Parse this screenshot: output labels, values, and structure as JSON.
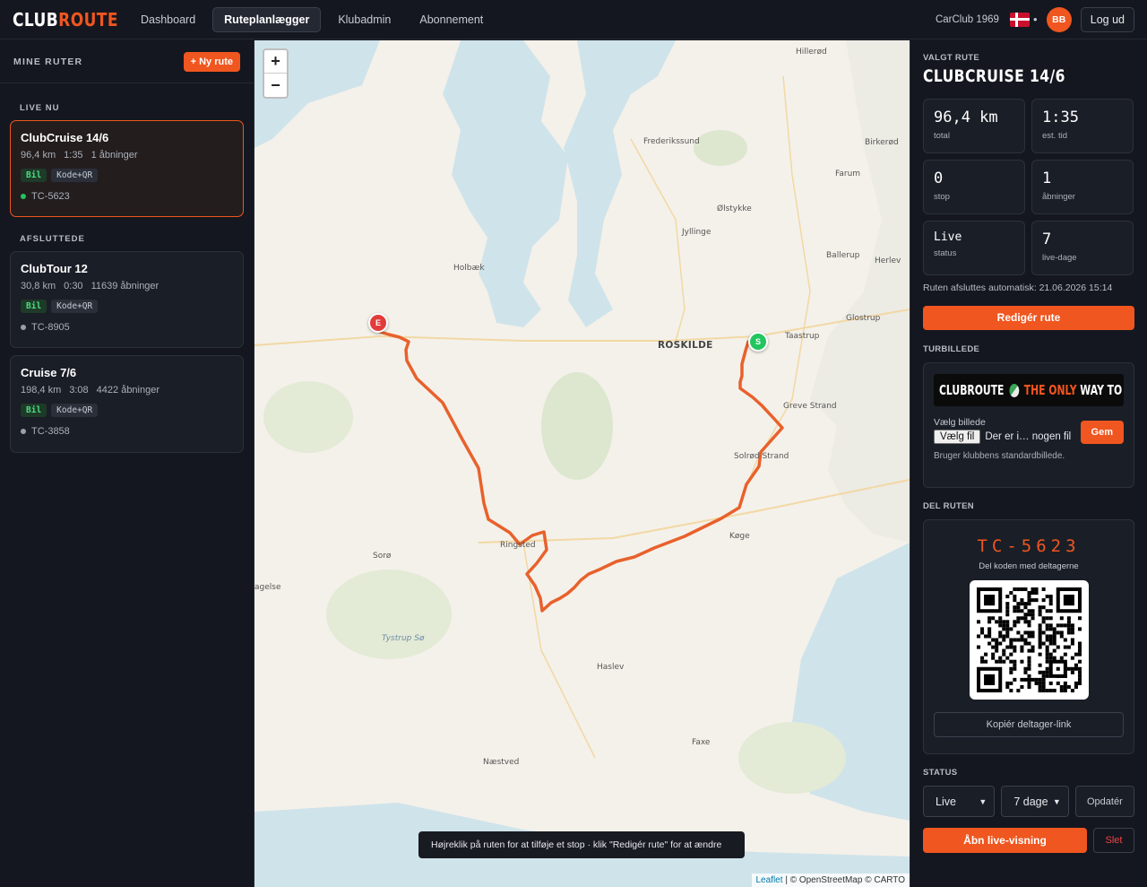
{
  "brand": {
    "part1": "CLUB",
    "part2": "ROUTE",
    "accent": "#f0561f"
  },
  "nav": {
    "items": [
      {
        "label": "Dashboard",
        "active": false
      },
      {
        "label": "Ruteplanlægger",
        "active": true
      },
      {
        "label": "Klubadmin",
        "active": false
      },
      {
        "label": "Abonnement",
        "active": false
      }
    ]
  },
  "header": {
    "club": "CarClub 1969",
    "language_flag": "denmark-flag-icon",
    "avatar": "BB",
    "logout": "Log ud"
  },
  "sidebar": {
    "title": "MINE RUTER",
    "new_route": "+ Ny rute",
    "live_label": "LIVE NU",
    "finished_label": "AFSLUTTEDE",
    "live_routes": [
      {
        "name": "ClubCruise 14/6",
        "km": "96,4 km",
        "time": "1:35",
        "openings": "1 åbninger",
        "tag1": "Bil",
        "tag2": "Kode+QR",
        "code": "TC-5623"
      }
    ],
    "finished_routes": [
      {
        "name": "ClubTour 12",
        "km": "30,8 km",
        "time": "0:30",
        "openings": "11639 åbninger",
        "tag1": "Bil",
        "tag2": "Kode+QR",
        "code": "TC-8905"
      },
      {
        "name": "Cruise 7/6",
        "km": "198,4 km",
        "time": "3:08",
        "openings": "4422 åbninger",
        "tag1": "Bil",
        "tag2": "Kode+QR",
        "code": "TC-3858"
      }
    ]
  },
  "map": {
    "zoom_in": "+",
    "zoom_out": "−",
    "places": {
      "hillerod": "Hillerød",
      "frederikssund": "Frederikssund",
      "birkerod": "Birkerød",
      "farum": "Farum",
      "olstykke": "Ølstykke",
      "jyllinge": "Jyllinge",
      "ballerup": "Ballerup",
      "herlev": "Herlev",
      "holbaek": "Holbæk",
      "glostrup": "Glostrup",
      "roskilde": "ROSKILDE",
      "taastrup": "Taastrup",
      "greve": "Greve Strand",
      "solrod": "Solrød Strand",
      "koge": "Køge",
      "ringsted": "Ringsted",
      "soro": "Sorø",
      "slagelse": "agelse",
      "tystrup": "Tystrup Sø",
      "haslev": "Haslev",
      "faxe": "Faxe",
      "naestved": "Næstved"
    },
    "marker_end": "E",
    "marker_start": "S",
    "hint": "Højreklik på ruten for at tilføje et stop · klik \"Redigér rute\" for at ændre",
    "attribution_leaflet": "Leaflet",
    "attribution_rest": "| © OpenStreetMap © CARTO",
    "route_color": "#e8612c"
  },
  "selected": {
    "label": "VALGT RUTE",
    "title": "CLUBCRUISE 14/6",
    "stats": [
      {
        "value": "96,4 km",
        "label": "total"
      },
      {
        "value": "1:35",
        "label": "est. tid"
      },
      {
        "value": "0",
        "label": "stop"
      },
      {
        "value": "1",
        "label": "åbninger"
      },
      {
        "value": "Live",
        "label": "status"
      },
      {
        "value": "7",
        "label": "live-dage"
      }
    ],
    "auto_end": "Ruten afsluttes automatisk: 21.06.2026 15:14",
    "edit_button": "Redigér rute"
  },
  "turbillede": {
    "label": "TURBILLEDE",
    "banner_w1": "CLUBROUTE",
    "banner_o1": "THE ",
    "banner_o2": "ONLY",
    "banner_w2": " WAY TO GO",
    "choose_label": "Vælg billede",
    "file_button": "Vælg fil",
    "file_none": "Der er i… nogen fil",
    "save": "Gem",
    "note": "Bruger klubbens standardbillede."
  },
  "share": {
    "label": "DEL RUTEN",
    "code": "TC-5623",
    "sub": "Del koden med deltagerne",
    "copy": "Kopiér deltager-link"
  },
  "status": {
    "label": "STATUS",
    "state": "Live",
    "days": "7 dage",
    "update": "Opdatér",
    "open_live": "Åbn live-visning",
    "delete": "Slet"
  }
}
